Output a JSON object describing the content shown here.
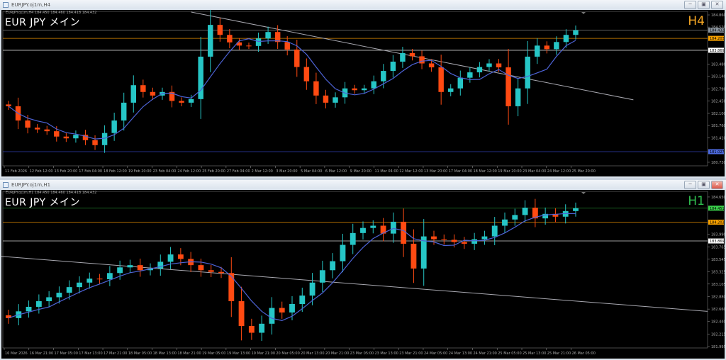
{
  "windows": [
    {
      "title": "EURJPY.oj1m,H4",
      "info": "EURJPY.oj1m,H4  184.450 184.460 184.418 184.432",
      "symbol_label": "EUR JPY  メイン",
      "timeframe_label": "H4",
      "timeframe_color": "#f5a623",
      "buttons": {
        "minimize": "─",
        "restore": "▣",
        "close": "✕"
      }
    },
    {
      "title": "EURJPY.oj1m,H1",
      "info": "EURJPY.oj1m,H1  184.450 184.460 184.418 184.432",
      "symbol_label": "EUR JPY  メイン",
      "timeframe_label": "H1",
      "timeframe_color": "#2fbf4f",
      "buttons": {
        "minimize": "─",
        "restore": "▣",
        "close": "✕"
      }
    }
  ],
  "colors": {
    "bull": "#26c6c6",
    "bear": "#ff4a12",
    "ma": "#4d63d6",
    "grid_axis": "#8a8a8a",
    "trendline": "#a8a8b0"
  },
  "chart_data": [
    {
      "type": "candlestick",
      "timeframe": "H4",
      "ylim": [
        180.63,
        184.96
      ],
      "yticks": [
        "184.860",
        "184.520",
        "183.480",
        "183.140",
        "182.790",
        "182.450",
        "182.100",
        "181.760",
        "181.410",
        "180.730"
      ],
      "xticks": [
        "11 Feb 2026",
        "12 Feb 12:00",
        "13 Feb 20:00",
        "17 Feb 04:00",
        "18 Feb 12:00",
        "19 Feb 20:00",
        "23 Feb 04:00",
        "24 Feb 12:00",
        "25 Feb 20:00",
        "27 Feb 04:00",
        "2 Mar 12:00",
        "3 Mar 20:00",
        "5 Mar 04:00",
        "6 Mar 12:00",
        "9 Mar 20:00",
        "11 Mar 04:00",
        "12 Mar 12:00",
        "13 Mar 20:00",
        "17 Mar 04:00",
        "18 Mar 12:00",
        "19 Mar 20:00",
        "23 Mar 04:00",
        "24 Mar 12:00",
        "25 Mar 20:00"
      ],
      "closes": [
        182.3,
        181.9,
        181.7,
        181.65,
        181.6,
        181.45,
        181.4,
        181.5,
        181.35,
        181.21,
        181.55,
        181.9,
        182.4,
        182.89,
        182.7,
        182.6,
        182.7,
        182.45,
        182.4,
        182.5,
        183.69,
        184.58,
        184.3,
        184.09,
        184.0,
        183.99,
        184.2,
        184.38,
        184.1,
        183.89,
        183.4,
        183.0,
        182.6,
        182.4,
        182.55,
        182.8,
        182.75,
        182.8,
        183.0,
        183.29,
        183.55,
        183.79,
        183.7,
        183.5,
        183.39,
        182.7,
        182.8,
        183.1,
        183.25,
        183.4,
        183.5,
        183.39,
        182.3,
        182.8,
        183.69,
        184.0,
        183.9,
        184.1,
        184.3,
        184.43
      ],
      "hlines": [
        {
          "price": 184.432,
          "label": "184.432",
          "color": "#6b6b6b",
          "label_bg": "#8a949e"
        },
        {
          "price": 184.203,
          "label": "184.203",
          "color": "#e08a00",
          "label_bg": "#f5a000"
        },
        {
          "price": 183.869,
          "label": "183.869",
          "color": "#cfcfcf",
          "label_bg": "#ffffff"
        },
        {
          "price": 181.027,
          "label": "181.027",
          "color": "#2f3fb0",
          "label_bg": "#4d6be0"
        }
      ],
      "trendline": {
        "from": [
          19,
          184.94
        ],
        "to": [
          65,
          182.48
        ]
      }
    },
    {
      "type": "candlestick",
      "timeframe": "H1",
      "ylim": [
        181.97,
        184.75
      ],
      "yticks": [
        "184.650",
        "183.990",
        "183.765",
        "183.545",
        "183.325",
        "183.105",
        "182.880",
        "182.660",
        "182.440",
        "182.215",
        "181.995"
      ],
      "xticks": [
        "16 Mar 2026",
        "16 Mar 21:00",
        "17 Mar 05:00",
        "17 Mar 13:00",
        "17 Mar 21:00",
        "18 Mar 05:00",
        "18 Mar 13:00",
        "18 Mar 21:00",
        "19 Mar 05:00",
        "19 Mar 13:00",
        "19 Mar 21:00",
        "20 Mar 05:00",
        "20 Mar 13:00",
        "20 Mar 21:00",
        "23 Mar 05:00",
        "23 Mar 13:00",
        "23 Mar 21:00",
        "24 Mar 05:00",
        "24 Mar 13:00",
        "24 Mar 21:00",
        "25 Mar 05:00",
        "25 Mar 13:00",
        "25 Mar 21:00",
        "26 Mar 05:00"
      ],
      "closes": [
        182.5,
        182.62,
        182.7,
        182.8,
        182.87,
        182.95,
        183.05,
        183.13,
        183.2,
        183.19,
        183.3,
        183.4,
        183.44,
        183.35,
        183.38,
        183.5,
        183.63,
        183.55,
        183.44,
        183.35,
        183.32,
        183.3,
        182.8,
        182.36,
        182.24,
        182.4,
        182.68,
        182.6,
        182.75,
        182.9,
        183.13,
        183.35,
        183.51,
        183.8,
        184.01,
        184.1,
        184.14,
        184.0,
        184.21,
        183.82,
        183.38,
        183.95,
        183.9,
        183.89,
        183.85,
        183.82,
        183.9,
        183.95,
        184.14,
        184.25,
        184.33,
        184.46,
        184.27,
        184.35,
        184.3,
        184.4,
        184.45
      ],
      "hlines": [
        {
          "price": 184.451,
          "label": "184.451",
          "color": "#1f7a2a",
          "label_bg": "#3ad04a"
        },
        {
          "price": 184.203,
          "label": "184.203",
          "color": "#e08a00",
          "label_bg": "#f5a000"
        },
        {
          "price": 183.869,
          "label": "183.869",
          "color": "#cfcfcf",
          "label_bg": "#ffffff"
        }
      ],
      "trendline": {
        "from": [
          -1,
          183.6
        ],
        "to": [
          72,
          182.62
        ]
      }
    }
  ]
}
